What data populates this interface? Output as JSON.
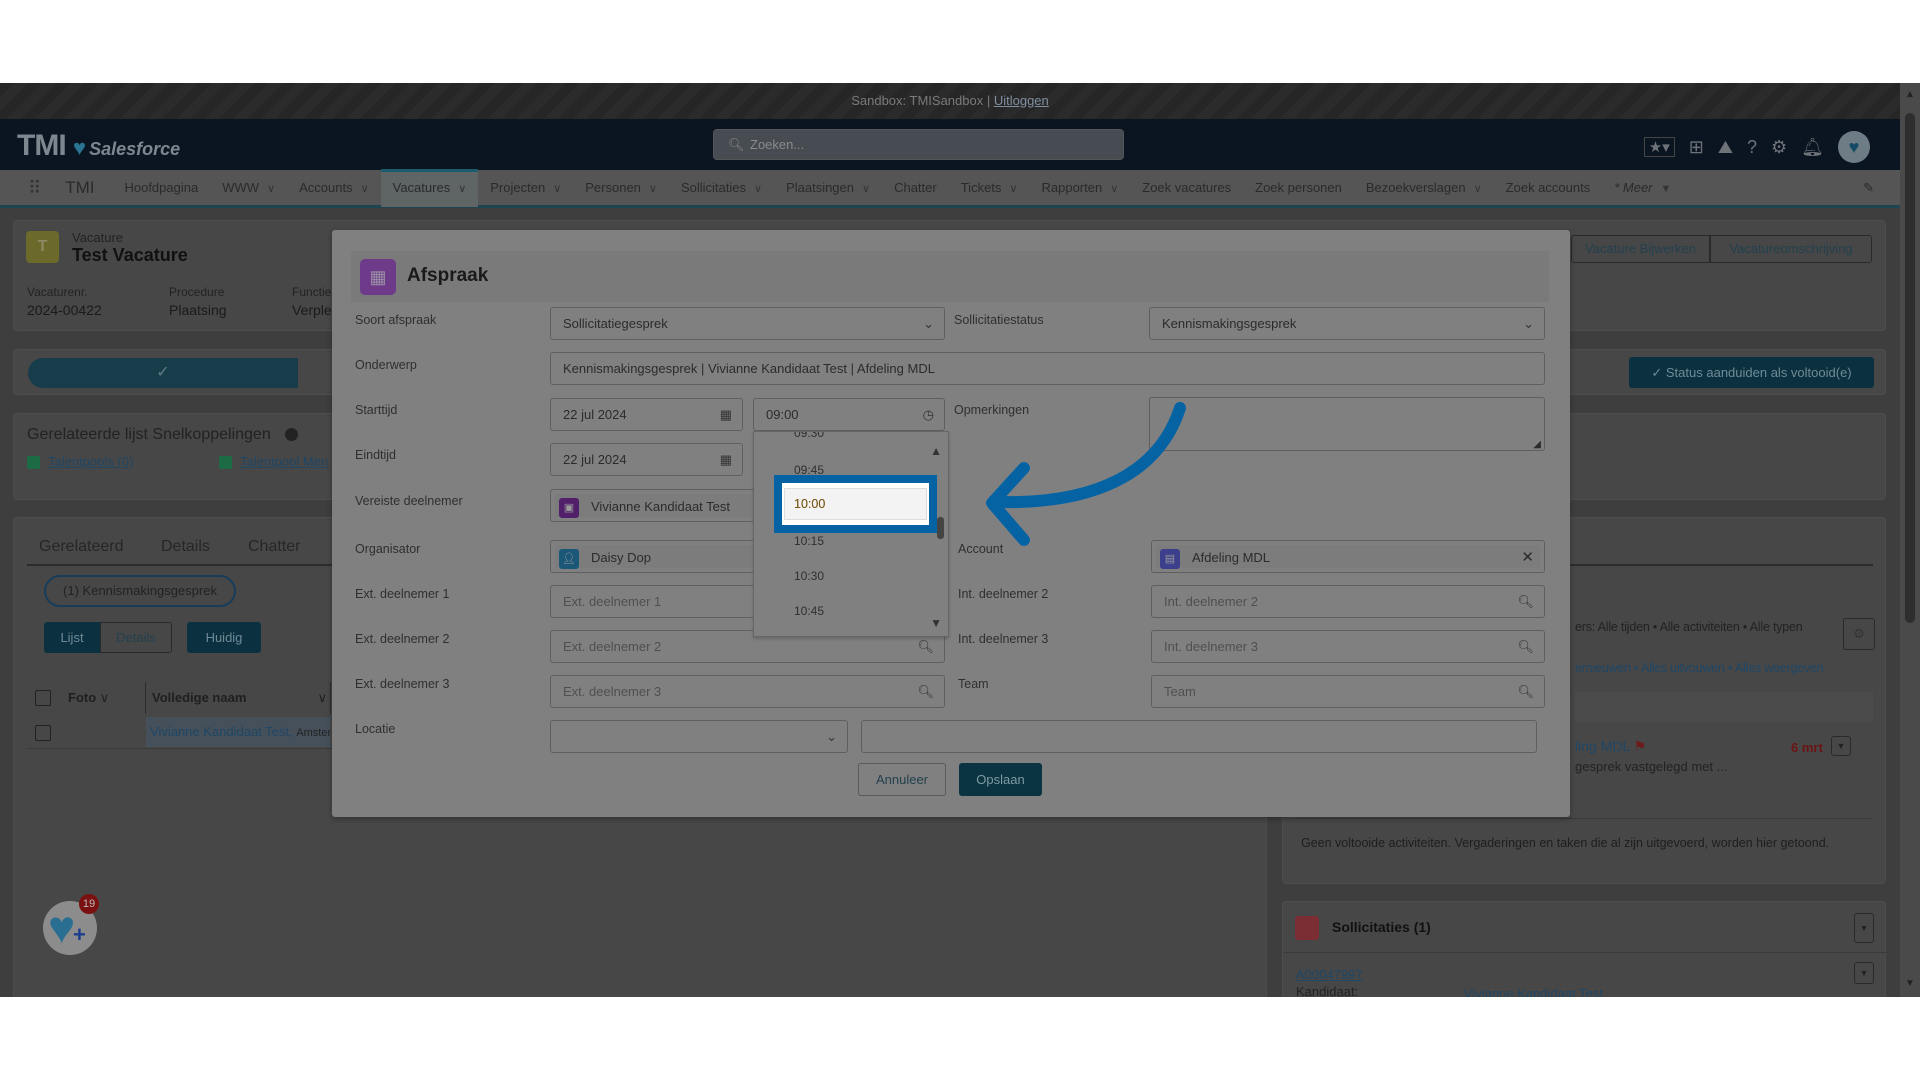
{
  "sandbox_bar": {
    "text": "Sandbox: TMISandbox |",
    "logout": "Uitloggen"
  },
  "header": {
    "logo_text": "TMI",
    "logo_sub": "Salesforce",
    "search_placeholder": "Zoeken...",
    "icons": [
      "favorites-star-icon",
      "add-icon",
      "trailhead-icon",
      "help-icon",
      "settings-gear-icon",
      "notification-bell-icon",
      "avatar"
    ]
  },
  "nav": {
    "app_name": "TMI",
    "items": [
      {
        "label": "Hoofdpagina",
        "dropdown": false
      },
      {
        "label": "WWW",
        "dropdown": true
      },
      {
        "label": "Accounts",
        "dropdown": true
      },
      {
        "label": "Vacatures",
        "dropdown": true,
        "active": true
      },
      {
        "label": "Projecten",
        "dropdown": true
      },
      {
        "label": "Personen",
        "dropdown": true
      },
      {
        "label": "Sollicitaties",
        "dropdown": true
      },
      {
        "label": "Plaatsingen",
        "dropdown": true
      },
      {
        "label": "Chatter",
        "dropdown": false
      },
      {
        "label": "Tickets",
        "dropdown": true
      },
      {
        "label": "Rapporten",
        "dropdown": true
      },
      {
        "label": "Zoek vacatures",
        "dropdown": false
      },
      {
        "label": "Zoek personen",
        "dropdown": false
      },
      {
        "label": "Bezoekverslagen",
        "dropdown": true
      },
      {
        "label": "Zoek accounts",
        "dropdown": false
      },
      {
        "label": "* Meer",
        "dropdown": true
      }
    ]
  },
  "record": {
    "object_label": "Vacature",
    "title": "Test Vacature",
    "fields": [
      {
        "label": "Vacaturenr.",
        "value": "2024-00422"
      },
      {
        "label": "Procedure",
        "value": "Plaatsing"
      },
      {
        "label": "Functie",
        "value": "Verple"
      }
    ],
    "actions": [
      "Vacature Bijwerken",
      "Vacatureomschrijving"
    ],
    "status_button": "Status aanduiden als voltooid(e)"
  },
  "quicklinks": {
    "title": "Gerelateerde lijst Snelkoppelingen",
    "links": [
      "Talentpools (0)",
      "Talentpool Men"
    ]
  },
  "tabs": {
    "items": [
      "Gerelateerd",
      "Details",
      "Chatter"
    ],
    "chip": "(1) Kennismakingsgesprek",
    "view_buttons": [
      "Lijst",
      "Details"
    ],
    "current_button": "Huidig",
    "columns": [
      "Foto",
      "Volledige naam",
      "S"
    ],
    "rows": [
      {
        "name": "Vivianne Kandidaat Test,",
        "city": "Amster",
        "extra": "K"
      }
    ]
  },
  "activity": {
    "filters": "ers: Alle tijden • Alle activiteiten • Alle typen",
    "links": [
      "ernieuwen",
      "Alles uitvouwen",
      "Alles weergeven"
    ],
    "item_title": "ling MDL",
    "item_date": "6 mrt",
    "item_desc": "gesprek vastgelegd met ...",
    "empty_text": "Geen voltooide activiteiten. Vergaderingen en taken die al zijn uitgevoerd, worden hier getoond."
  },
  "sollicitaties": {
    "title": "Sollicitaties (1)",
    "record": "A00047997",
    "field_label": "Kandidaat:",
    "field_value": "Vivianne Kandidaat Test"
  },
  "fab": {
    "badge": "19"
  },
  "dialog": {
    "title": "Afspraak",
    "fields": {
      "soort_afspraak": {
        "label": "Soort afspraak",
        "value": "Sollicitatiegesprek"
      },
      "sollicitatiestatus": {
        "label": "Sollicitatiestatus",
        "value": "Kennismakingsgesprek"
      },
      "onderwerp": {
        "label": "Onderwerp",
        "value": "Kennismakingsgesprek | Vivianne Kandidaat Test | Afdeling MDL"
      },
      "starttijd": {
        "label": "Starttijd",
        "date": "22 jul 2024",
        "time": "09:00"
      },
      "opmerkingen": {
        "label": "Opmerkingen",
        "value": ""
      },
      "eindtijd": {
        "label": "Eindtijd",
        "date": "22 jul 2024"
      },
      "vereiste_deelnemer": {
        "label": "Vereiste deelnemer",
        "value": "Vivianne Kandidaat Test"
      },
      "organisator": {
        "label": "Organisator",
        "value": "Daisy Dop"
      },
      "account": {
        "label": "Account",
        "value": "Afdeling MDL"
      },
      "ext1": {
        "label": "Ext. deelnemer 1",
        "placeholder": "Ext. deelnemer 1"
      },
      "ext2": {
        "label": "Ext. deelnemer 2",
        "placeholder": "Ext. deelnemer 2"
      },
      "ext3": {
        "label": "Ext. deelnemer 3",
        "placeholder": "Ext. deelnemer 3"
      },
      "int2": {
        "label": "Int. deelnemer 2",
        "placeholder": "Int. deelnemer 2"
      },
      "int3": {
        "label": "Int. deelnemer 3",
        "placeholder": "Int. deelnemer 3"
      },
      "team": {
        "label": "Team",
        "placeholder": "Team"
      },
      "locatie": {
        "label": "Locatie",
        "value": ""
      }
    },
    "time_options": [
      "09:30",
      "09:45",
      "10:00",
      "10:15",
      "10:30",
      "10:45"
    ],
    "highlighted_option": "10:00",
    "cancel": "Annuleer",
    "save": "Opslaan"
  },
  "annotation": {
    "color": "#0563a4",
    "arrow": "curved-arrow-pointing-left"
  }
}
